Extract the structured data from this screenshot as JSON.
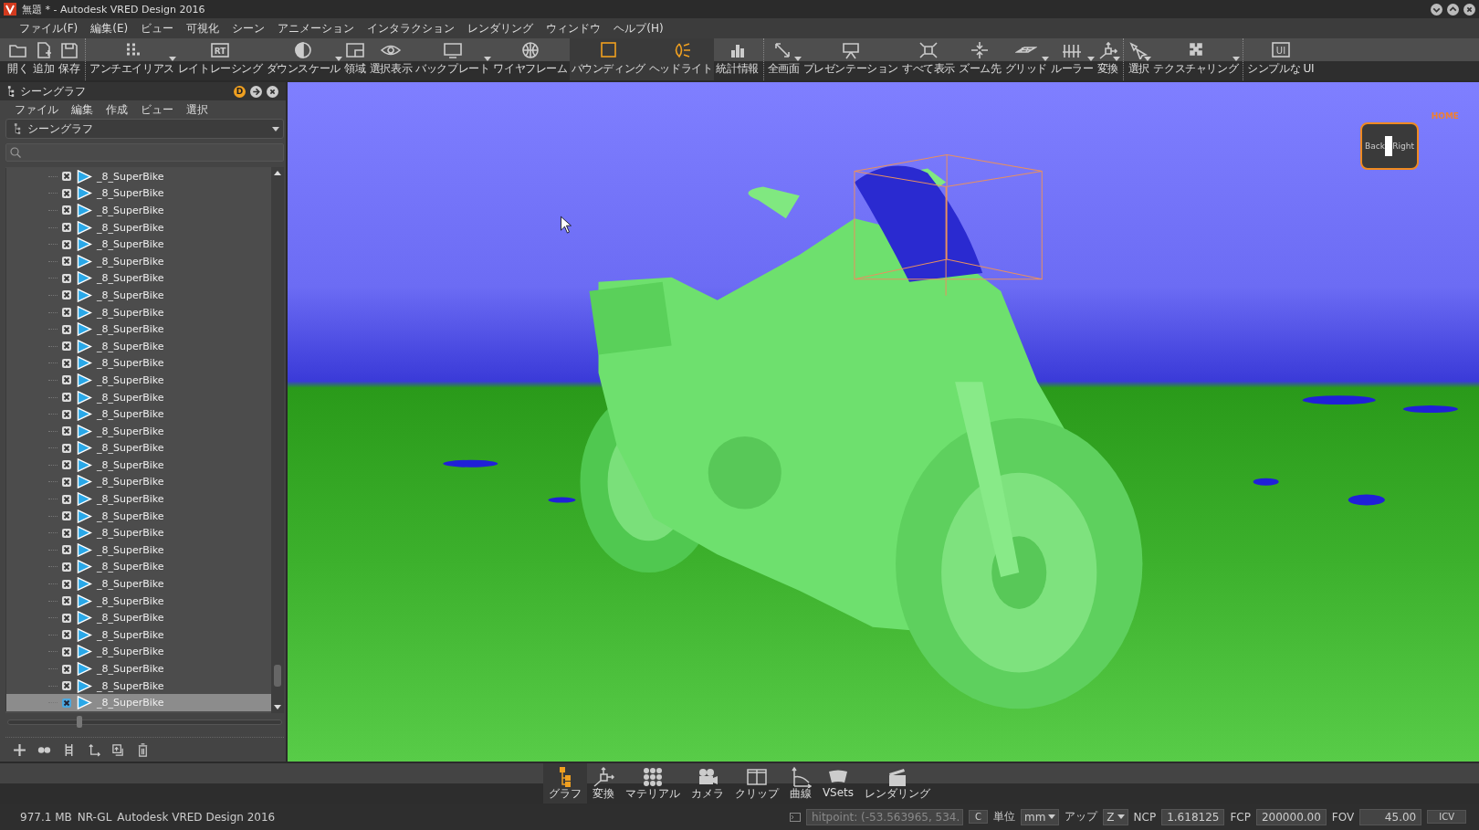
{
  "window": {
    "title": "無題 * - Autodesk VRED Design 2016"
  },
  "menu": [
    "ファイル(F)",
    "編集(E)",
    "ビュー",
    "可視化",
    "シーン",
    "アニメーション",
    "インタラクション",
    "レンダリング",
    "ウィンドウ",
    "ヘルプ(H)"
  ],
  "toolbar": [
    {
      "label": "開く",
      "dropdown": false,
      "on": false,
      "separator_before": false
    },
    {
      "label": "追加",
      "dropdown": false,
      "on": false,
      "separator_before": false
    },
    {
      "label": "保存",
      "dropdown": false,
      "on": false,
      "separator_before": false
    },
    {
      "label": "アンチエイリアス",
      "dropdown": true,
      "on": false,
      "separator_before": true
    },
    {
      "label": "レイトレーシング",
      "icon_text": "RT",
      "dropdown": false,
      "on": false,
      "separator_before": false
    },
    {
      "label": "ダウンスケール",
      "dropdown": true,
      "on": false,
      "separator_before": false
    },
    {
      "label": "領域",
      "dropdown": false,
      "on": false,
      "separator_before": false
    },
    {
      "label": "選択表示",
      "dropdown": false,
      "on": false,
      "separator_before": false
    },
    {
      "label": "バックプレート",
      "dropdown": true,
      "on": false,
      "separator_before": false
    },
    {
      "label": "ワイヤフレーム",
      "dropdown": false,
      "on": false,
      "separator_before": false
    },
    {
      "label": "バウンディング",
      "dropdown": false,
      "on": true,
      "separator_before": false
    },
    {
      "label": "ヘッドライト",
      "dropdown": false,
      "on": true,
      "separator_before": false
    },
    {
      "label": "統計情報",
      "dropdown": false,
      "on": false,
      "separator_before": false
    },
    {
      "label": "全画面",
      "dropdown": true,
      "on": false,
      "separator_before": true
    },
    {
      "label": "プレゼンテーション",
      "dropdown": false,
      "on": false,
      "separator_before": false
    },
    {
      "label": "すべて表示",
      "dropdown": false,
      "on": false,
      "separator_before": false
    },
    {
      "label": "ズーム先",
      "dropdown": false,
      "on": false,
      "separator_before": false
    },
    {
      "label": "グリッド",
      "dropdown": true,
      "on": false,
      "separator_before": false
    },
    {
      "label": "ルーラー",
      "dropdown": true,
      "on": false,
      "separator_before": false
    },
    {
      "label": "変換",
      "dropdown": true,
      "on": false,
      "separator_before": false
    },
    {
      "label": "選択",
      "dropdown": true,
      "on": false,
      "separator_before": true
    },
    {
      "label": "テクスチャリング",
      "dropdown": true,
      "on": false,
      "separator_before": false
    },
    {
      "label": "シンプルな UI",
      "icon_text": "UI",
      "dropdown": false,
      "on": false,
      "separator_before": true
    }
  ],
  "scenegraph": {
    "title": "シーングラフ",
    "badge": "D",
    "menu": [
      "ファイル",
      "編集",
      "作成",
      "ビュー",
      "選択"
    ],
    "view_select": "シーングラフ",
    "zoom_slider": {
      "level": 0.26
    },
    "nodes": [
      {
        "name": "_8_SuperBike",
        "checked": true,
        "selected": false
      },
      {
        "name": "_8_SuperBike",
        "checked": true,
        "selected": false
      },
      {
        "name": "_8_SuperBike",
        "checked": true,
        "selected": false
      },
      {
        "name": "_8_SuperBike",
        "checked": true,
        "selected": false
      },
      {
        "name": "_8_SuperBike",
        "checked": true,
        "selected": false
      },
      {
        "name": "_8_SuperBike",
        "checked": true,
        "selected": false
      },
      {
        "name": "_8_SuperBike",
        "checked": true,
        "selected": false
      },
      {
        "name": "_8_SuperBike",
        "checked": true,
        "selected": false
      },
      {
        "name": "_8_SuperBike",
        "checked": true,
        "selected": false
      },
      {
        "name": "_8_SuperBike",
        "checked": true,
        "selected": false
      },
      {
        "name": "_8_SuperBike",
        "checked": true,
        "selected": false
      },
      {
        "name": "_8_SuperBike",
        "checked": true,
        "selected": false
      },
      {
        "name": "_8_SuperBike",
        "checked": true,
        "selected": false
      },
      {
        "name": "_8_SuperBike",
        "checked": true,
        "selected": false
      },
      {
        "name": "_8_SuperBike",
        "checked": true,
        "selected": false
      },
      {
        "name": "_8_SuperBike",
        "checked": true,
        "selected": false
      },
      {
        "name": "_8_SuperBike",
        "checked": true,
        "selected": false
      },
      {
        "name": "_8_SuperBike",
        "checked": true,
        "selected": false
      },
      {
        "name": "_8_SuperBike",
        "checked": true,
        "selected": false
      },
      {
        "name": "_8_SuperBike",
        "checked": true,
        "selected": false
      },
      {
        "name": "_8_SuperBike",
        "checked": true,
        "selected": false
      },
      {
        "name": "_8_SuperBike",
        "checked": true,
        "selected": false
      },
      {
        "name": "_8_SuperBike",
        "checked": true,
        "selected": false
      },
      {
        "name": "_8_SuperBike",
        "checked": true,
        "selected": false
      },
      {
        "name": "_8_SuperBike",
        "checked": true,
        "selected": false
      },
      {
        "name": "_8_SuperBike",
        "checked": true,
        "selected": false
      },
      {
        "name": "_8_SuperBike",
        "checked": true,
        "selected": false
      },
      {
        "name": "_8_SuperBike",
        "checked": true,
        "selected": false
      },
      {
        "name": "_8_SuperBike",
        "checked": true,
        "selected": false
      },
      {
        "name": "_8_SuperBike",
        "checked": true,
        "selected": false
      },
      {
        "name": "_8_SuperBike",
        "checked": true,
        "selected": false
      },
      {
        "name": "_8_SuperBike",
        "checked": true,
        "selected": true
      }
    ]
  },
  "viewport": {
    "home_label": "HOME",
    "cube_faces": [
      "Back",
      "Right"
    ]
  },
  "dock": [
    {
      "label": "グラフ",
      "selected": true
    },
    {
      "label": "変換",
      "selected": false
    },
    {
      "label": "マテリアル",
      "selected": false
    },
    {
      "label": "カメラ",
      "selected": false
    },
    {
      "label": "クリップ",
      "selected": false
    },
    {
      "label": "曲線",
      "selected": false
    },
    {
      "label": "VSets",
      "selected": false
    },
    {
      "label": "レンダリング",
      "selected": false
    }
  ],
  "status_bar": {
    "memory": "977.1 MB",
    "renderer": "NR-GL",
    "app": "Autodesk VRED Design 2016",
    "hitpoint": "hitpoint: (-53.563965, 534.",
    "c_button": "C",
    "unit_label": "単位",
    "unit": "mm",
    "up_label": "アップ",
    "up": "Z",
    "ncp_label": "NCP",
    "ncp": "1.618125",
    "fcp_label": "FCP",
    "fcp": "200000.00",
    "fov_label": "FOV",
    "fov": "45.00",
    "icv_button": "ICV"
  }
}
